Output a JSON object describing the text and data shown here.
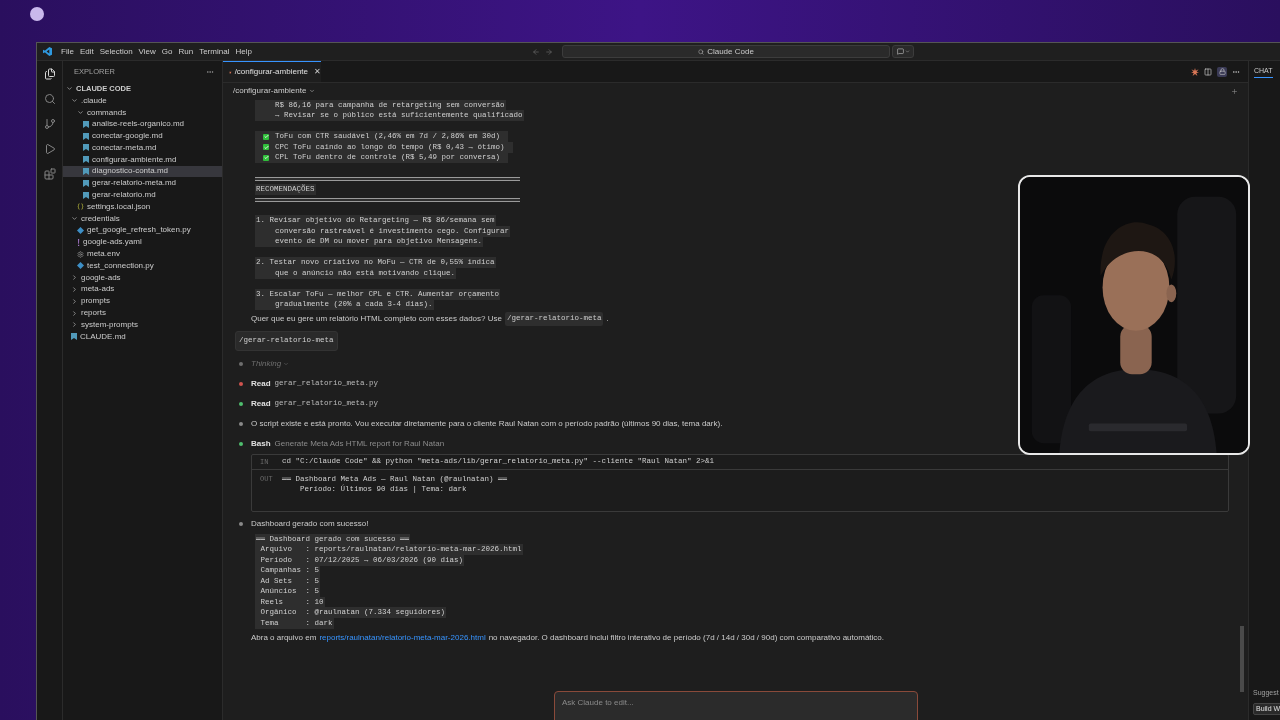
{
  "menu": [
    "File",
    "Edit",
    "Selection",
    "View",
    "Go",
    "Run",
    "Terminal",
    "Help"
  ],
  "search": "Claude Code",
  "explorer": {
    "title": "EXPLORER",
    "root": "CLAUDE CODE",
    "tree": [
      {
        "name": ".claude",
        "kind": "folder",
        "expanded": true,
        "selected": false,
        "children": [
          {
            "name": "commands",
            "kind": "folder",
            "expanded": true,
            "selected": false,
            "children": [
              {
                "name": "analise-reels-organico.md",
                "kind": "md",
                "selected": false
              },
              {
                "name": "conectar-google.md",
                "kind": "md",
                "selected": false
              },
              {
                "name": "conectar-meta.md",
                "kind": "md",
                "selected": false
              },
              {
                "name": "configurar-ambiente.md",
                "kind": "md",
                "selected": false
              },
              {
                "name": "diagnostico-conta.md",
                "kind": "md",
                "selected": true
              },
              {
                "name": "gerar-relatorio-meta.md",
                "kind": "md",
                "selected": false
              },
              {
                "name": "gerar-relatorio.md",
                "kind": "md",
                "selected": false
              }
            ]
          },
          {
            "name": "settings.local.json",
            "kind": "json",
            "selected": false
          }
        ]
      },
      {
        "name": "credentials",
        "kind": "folder",
        "expanded": true,
        "selected": false,
        "children": [
          {
            "name": "get_google_refresh_token.py",
            "kind": "py",
            "selected": false
          },
          {
            "name": "google-ads.yaml",
            "kind": "yaml",
            "selected": false
          },
          {
            "name": "meta.env",
            "kind": "env",
            "selected": false
          },
          {
            "name": "test_connection.py",
            "kind": "py",
            "selected": false
          }
        ]
      },
      {
        "name": "google-ads",
        "kind": "folder",
        "expanded": false,
        "selected": false
      },
      {
        "name": "meta-ads",
        "kind": "folder",
        "expanded": false,
        "selected": false
      },
      {
        "name": "prompts",
        "kind": "folder",
        "expanded": false,
        "selected": false
      },
      {
        "name": "reports",
        "kind": "folder",
        "expanded": false,
        "selected": false
      },
      {
        "name": "system-prompts",
        "kind": "folder",
        "expanded": false,
        "selected": false
      },
      {
        "name": "CLAUDE.md",
        "kind": "md",
        "selected": false
      }
    ]
  },
  "tab": {
    "label": "/configurar-ambiente",
    "close": "✕"
  },
  "header": "/configurar-ambiente",
  "chat_tab": "CHAT",
  "conversation": [
    {
      "kind": "code",
      "lines": [
        {
          "kind": "line",
          "text": "R$ 86,16 para campanha de retargeting sem conversão",
          "indent": true
        },
        {
          "kind": "line",
          "text": "→ Revisar se o público está suficientemente qualificado",
          "indent": true
        },
        {
          "kind": "gap"
        },
        {
          "kind": "check",
          "text": "ToFu com CTR saudável (2,46% em 7d / 2,86% em 30d)"
        },
        {
          "kind": "check",
          "text": "CPC ToFu caindo ao longo do tempo (R$ 0,43 → ótimo)"
        },
        {
          "kind": "check",
          "text": "CPL ToFu dentro de controle (R$ 5,49 por conversa)"
        },
        {
          "kind": "gap"
        },
        {
          "kind": "rule"
        },
        {
          "kind": "line",
          "text": "RECOMENDAÇÕES",
          "indent": false
        },
        {
          "kind": "rule"
        },
        {
          "kind": "gap"
        },
        {
          "kind": "line",
          "text": "1. Revisar objetivo do Retargeting — R$ 86/semana sem",
          "indent": false
        },
        {
          "kind": "line",
          "text": "conversão rastreável é investimento cego. Configurar",
          "indent": true
        },
        {
          "kind": "line",
          "text": "evento de DM ou mover para objetivo Mensagens.",
          "indent": true
        },
        {
          "kind": "gap"
        },
        {
          "kind": "line",
          "text": "2. Testar novo criativo no MoFu — CTR de 0,55% indica",
          "indent": false
        },
        {
          "kind": "line",
          "text": "que o anúncio não está motivando clique.",
          "indent": true
        },
        {
          "kind": "gap"
        },
        {
          "kind": "line",
          "text": "3. Escalar ToFu — melhor CPL e CTR. Aumentar orçamento",
          "indent": false
        },
        {
          "kind": "line",
          "text": "gradualmente (20% a cada 3-4 dias).",
          "indent": true
        }
      ]
    },
    {
      "kind": "paragraph",
      "parts": [
        {
          "kind": "text",
          "text": "Quer que eu gere um relatório HTML completo com esses dados? Use"
        },
        {
          "kind": "code",
          "text": "/gerar-relatorio-meta"
        },
        {
          "kind": "text",
          "text": "."
        }
      ]
    },
    {
      "kind": "user",
      "text": "/gerar-relatorio-meta"
    },
    {
      "kind": "thinking",
      "color": "#6e6e6e",
      "text": "Thinking"
    },
    {
      "kind": "tool",
      "color": "#d0534f",
      "tool": "Read",
      "detail": "gerar_relatorio_meta.py",
      "detail_mono": true
    },
    {
      "kind": "tool",
      "color": "#4fbf6e",
      "tool": "Read",
      "detail": "gerar_relatorio_meta.py",
      "detail_mono": true
    },
    {
      "kind": "message",
      "color": "#8a8a8a",
      "text": "O script existe e está pronto. Vou executar diretamente para o cliente Raul Natan com o período padrão (últimos 90 dias, tema dark)."
    },
    {
      "kind": "tool",
      "color": "#4fbf6e",
      "tool": "Bash",
      "detail": "Generate Meta Ads HTML report for Raul Natan",
      "detail_mono": false,
      "io": {
        "in_label": "IN",
        "command": "cd \"C:/Claude Code\" && python \"meta-ads/lib/gerar_relatorio_meta.py\" --cliente \"Raul Natan\" 2>&1",
        "out_label": "OUT",
        "output": [
          "══ Dashboard Meta Ads — Raul Natan (@raulnatan) ══",
          "    Período: Últimos 90 dias | Tema: dark"
        ]
      }
    },
    {
      "kind": "message",
      "color": "#8a8a8a",
      "text": "Dashboard gerado com sucesso!"
    },
    {
      "kind": "code",
      "lines": [
        {
          "kind": "line",
          "text": "══ Dashboard gerado com sucesso ══",
          "indent": false
        },
        {
          "kind": "line",
          "text": " Arquivo   : reports/raulnatan/relatorio-meta-mar-2026.html",
          "indent": false
        },
        {
          "kind": "line",
          "text": " Período   : 07/12/2025 → 06/03/2026 (90 dias)",
          "indent": false
        },
        {
          "kind": "line",
          "text": " Campanhas : 5",
          "indent": false
        },
        {
          "kind": "line",
          "text": " Ad Sets   : 5",
          "indent": false
        },
        {
          "kind": "line",
          "text": " Anúncios  : 5",
          "indent": false
        },
        {
          "kind": "line",
          "text": " Reels     : 10",
          "indent": false
        },
        {
          "kind": "line",
          "text": " Orgânico  : @raulnatan (7.334 seguidores)",
          "indent": false
        },
        {
          "kind": "line",
          "text": " Tema      : dark",
          "indent": false
        }
      ]
    },
    {
      "kind": "paragraph",
      "parts": [
        {
          "kind": "text",
          "text": "Abra o arquivo em"
        },
        {
          "kind": "link",
          "text": "reports/raulnatan/relatorio-meta-mar-2026.html"
        },
        {
          "kind": "text",
          "text": "no navegador. O dashboard inclui filtro interativo de período (7d / 14d / 30d / 90d) com comparativo automático."
        }
      ]
    }
  ],
  "input": {
    "placeholder": "Ask Claude to edit..."
  },
  "side_chat": {
    "label": "Suggest",
    "button": "Build W"
  },
  "webcam": {
    "kind": "picture"
  }
}
